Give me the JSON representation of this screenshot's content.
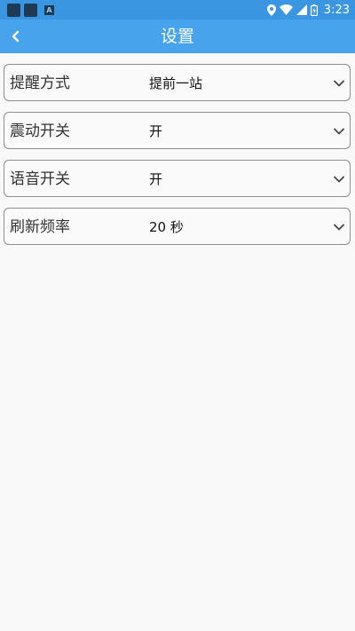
{
  "status_bar": {
    "time": "3:23",
    "left_icons": [
      "notification-square-icon",
      "notification-square-icon",
      "a-badge-icon"
    ],
    "a_badge": "A",
    "right_icons": [
      "location-icon",
      "wifi-icon",
      "signal-icon",
      "battery-icon"
    ]
  },
  "appbar": {
    "title": "设置",
    "back_icon": "chevron-left-icon"
  },
  "settings": [
    {
      "label": "提醒方式",
      "value": "提前一站"
    },
    {
      "label": "震动开关",
      "value": "开"
    },
    {
      "label": "语音开关",
      "value": "开"
    },
    {
      "label": "刷新频率",
      "value": "20 秒"
    }
  ],
  "colors": {
    "status_bar": "#3a96e0",
    "app_bar": "#47a4ec",
    "background": "#f9f9f9",
    "row_border": "#8e8e8e"
  }
}
